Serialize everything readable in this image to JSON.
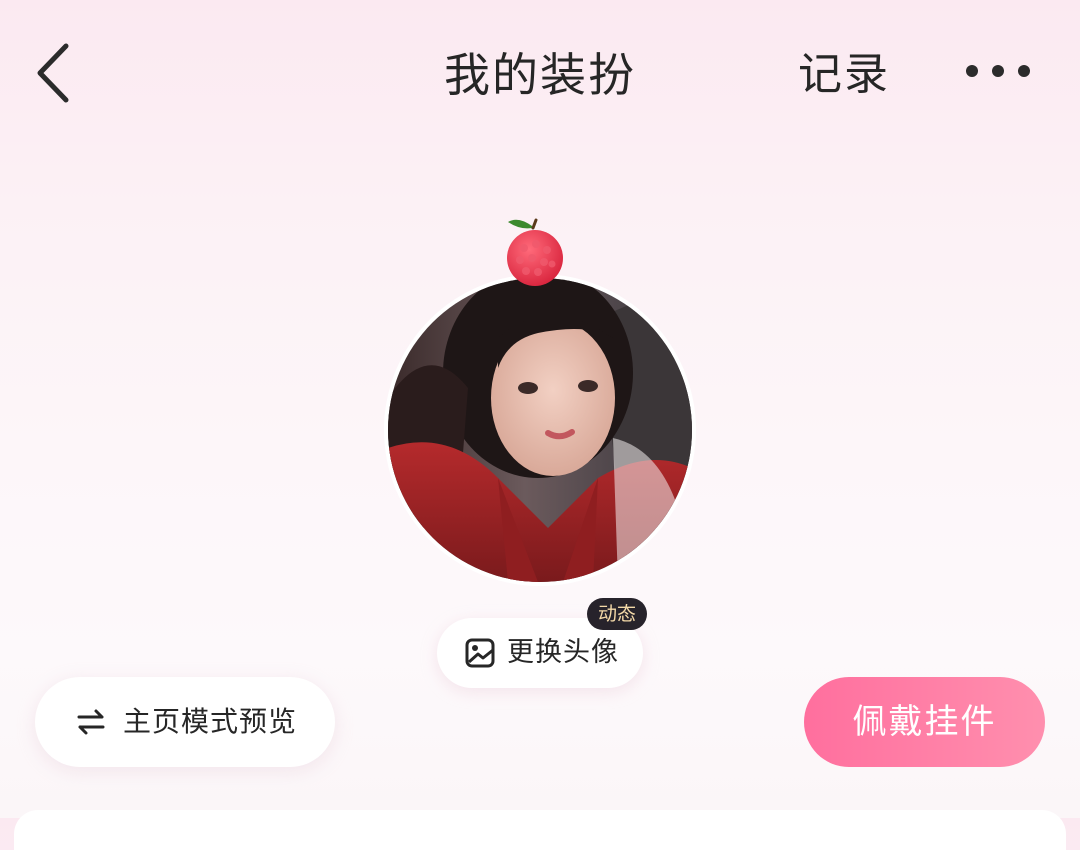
{
  "header": {
    "back_icon": "chevron-left-icon",
    "title": "我的装扮",
    "record_label": "记录",
    "more_icon": "more-horizontal-icon"
  },
  "avatar": {
    "pendant_icon": "lychee-pendant-icon",
    "change_label": "更换头像",
    "change_icon": "image-icon",
    "badge": "动态"
  },
  "actions": {
    "preview_label": "主页模式预览",
    "preview_icon": "swap-arrows-icon",
    "wear_label": "佩戴挂件"
  },
  "colors": {
    "accent_pink": "#ff7aa3",
    "badge_bg": "#27232b",
    "badge_text": "#f4d9a8",
    "text_primary": "#262626"
  }
}
